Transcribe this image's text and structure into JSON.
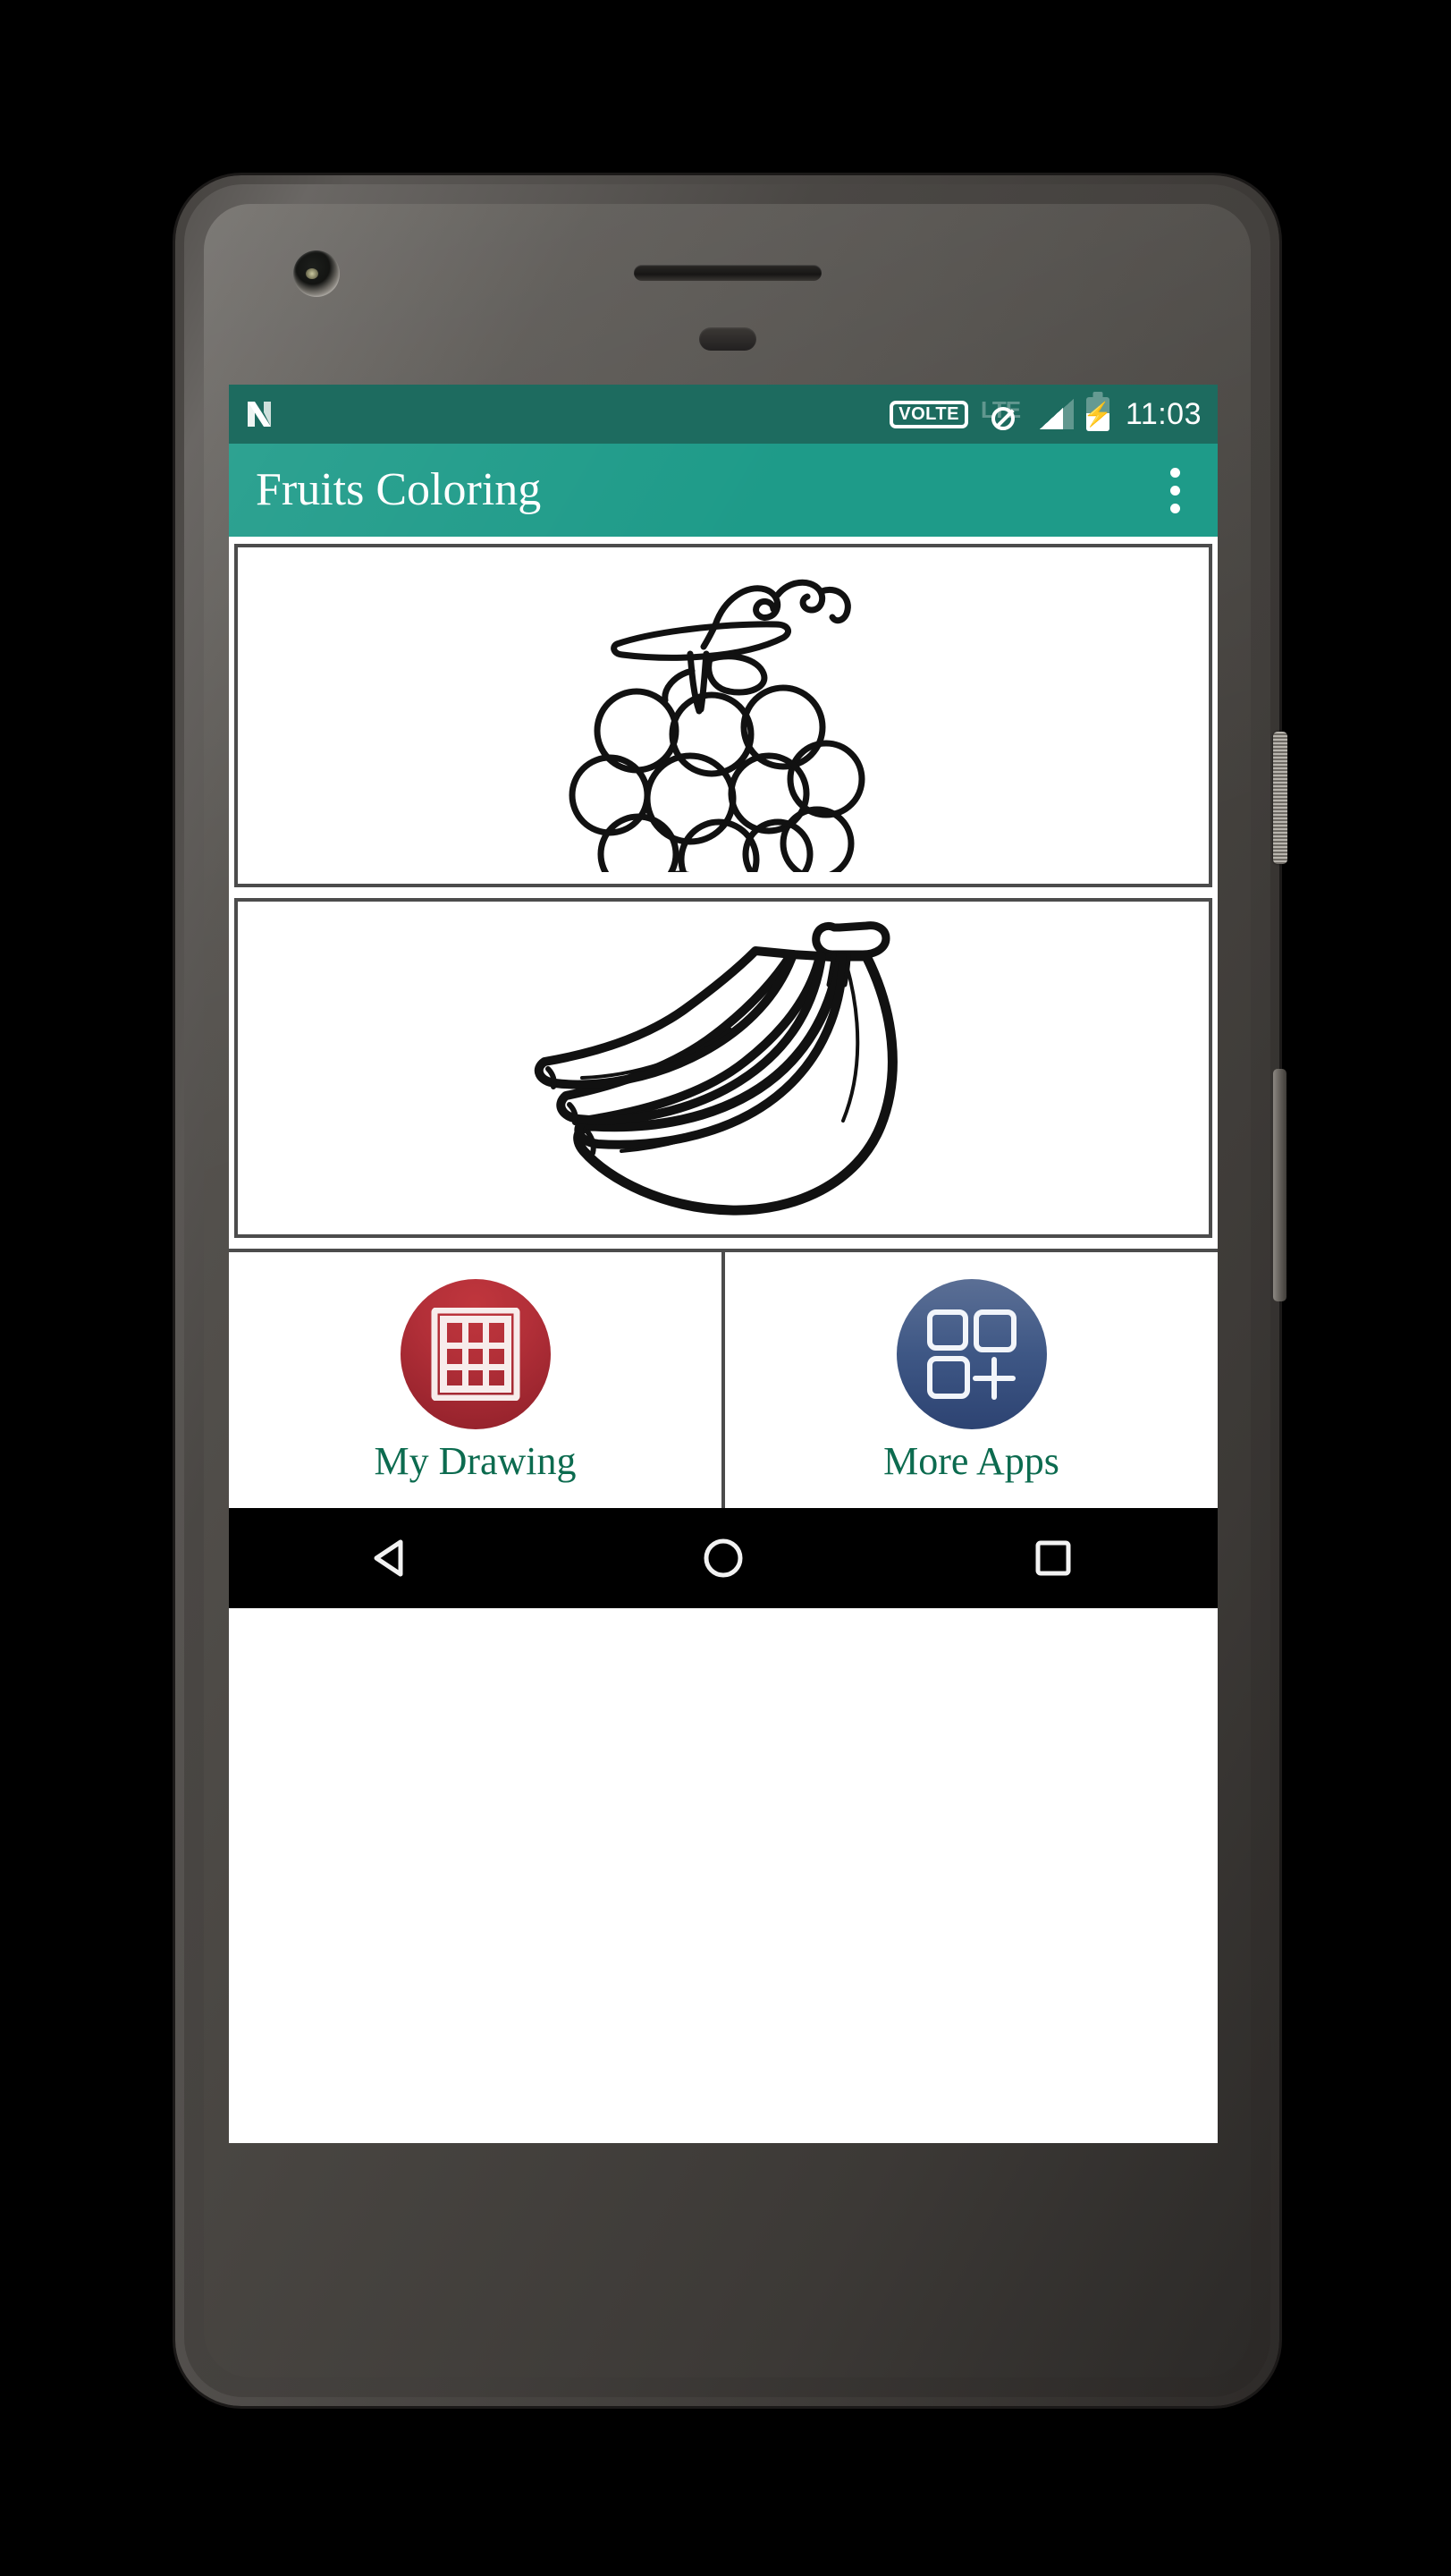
{
  "status_bar": {
    "os_logo": "android-n-logo",
    "volte_label": "VOLTE",
    "network_label": "LTE",
    "no_data_icon": "no-data-slash-icon",
    "signal_icon": "signal-bars-icon",
    "battery_icon": "battery-charging-icon",
    "time": "11:03",
    "bg_color": "#1D6B5F"
  },
  "app_bar": {
    "title": "Fruits Coloring",
    "overflow_menu": "more-options",
    "bg_color": "#1E9B89"
  },
  "content": {
    "cards": [
      {
        "name": "grapes",
        "label": "Grapes coloring page",
        "icon": "grapes-outline"
      },
      {
        "name": "bananas",
        "label": "Bananas coloring page",
        "icon": "bananas-outline"
      }
    ]
  },
  "actions": [
    {
      "id": "my-drawing",
      "label": "My Drawing",
      "icon": "grid-frame-icon",
      "color": "#B22F38"
    },
    {
      "id": "more-apps",
      "label": "More Apps",
      "icon": "apps-plus-icon",
      "color": "#3E5785"
    }
  ],
  "nav_bar": {
    "back": "back-triangle",
    "home": "home-circle",
    "recents": "recents-square",
    "bg_color": "#000000"
  },
  "device": {
    "power_button": "power-button",
    "volume_button": "volume-rocker",
    "camera": "front-camera",
    "speaker": "earpiece-speaker"
  }
}
